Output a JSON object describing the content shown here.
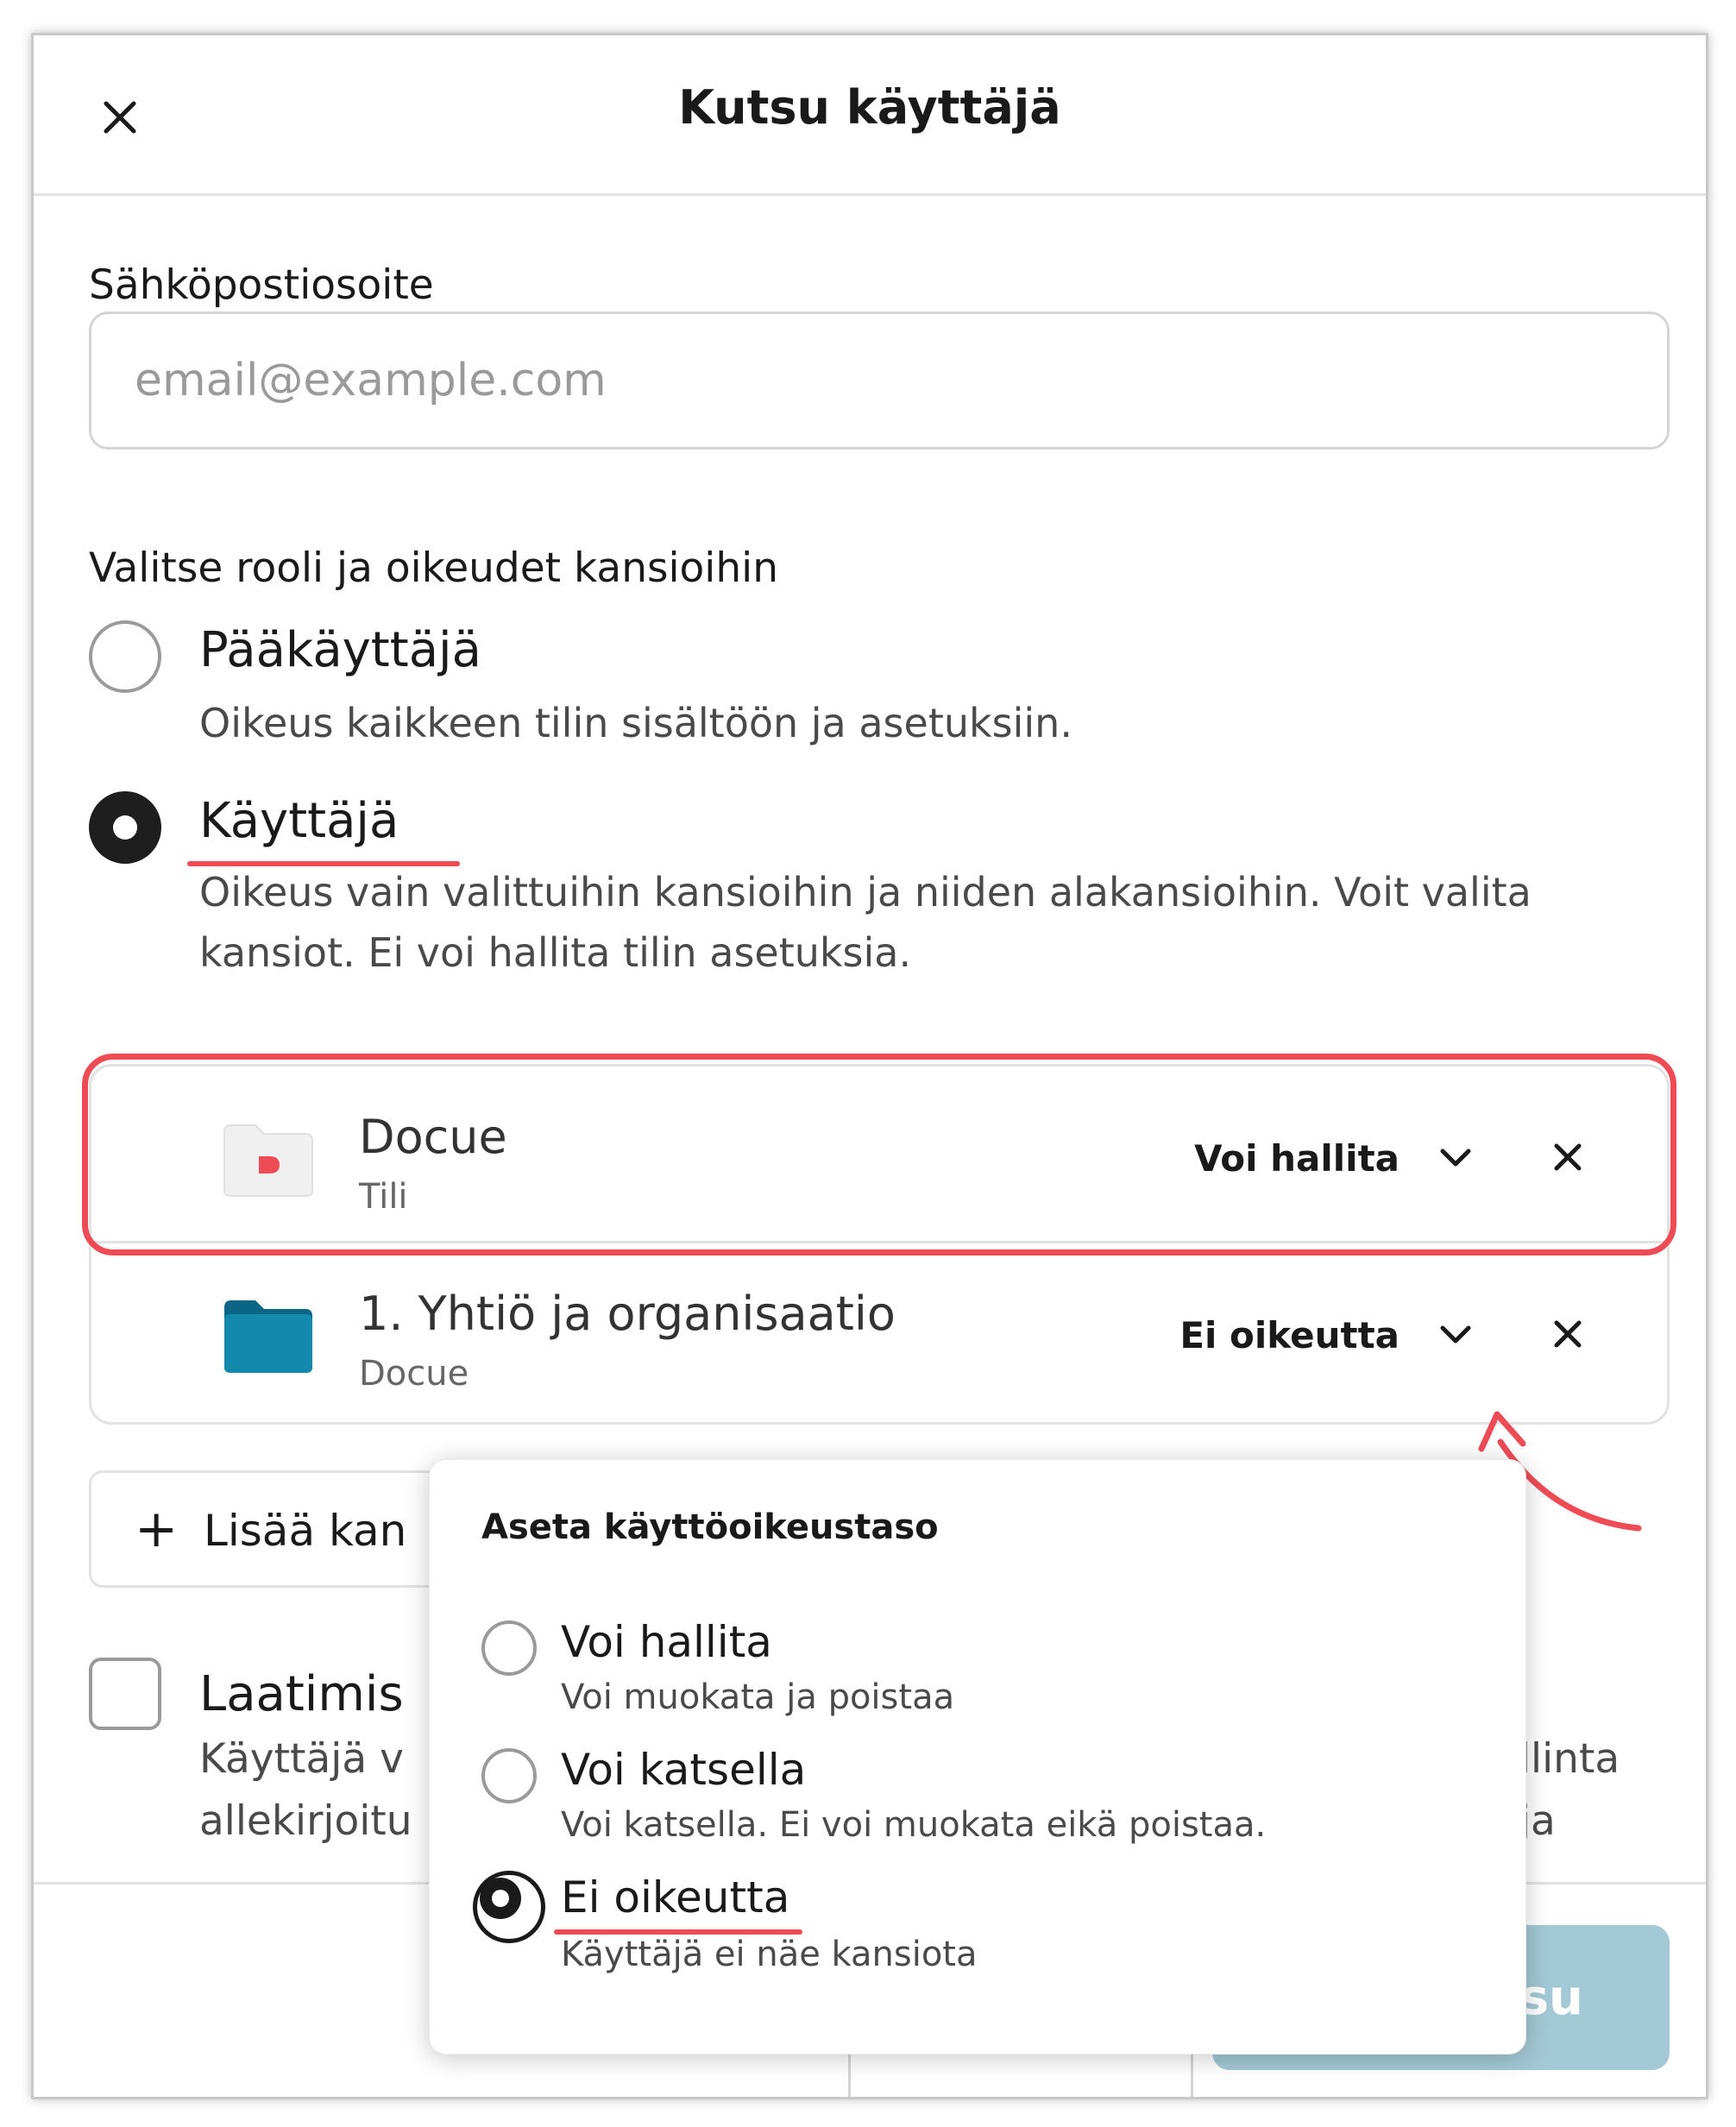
{
  "dialog": {
    "title": "Kutsu käyttäjä",
    "close_icon": "close-icon"
  },
  "email": {
    "label": "Sähköpostiosoite",
    "placeholder": "email@example.com",
    "value": ""
  },
  "role": {
    "heading": "Valitse rooli ja oikeudet kansioihin",
    "options": [
      {
        "title": "Pääkäyttäjä",
        "desc": "Oikeus kaikkeen tilin sisältöön ja asetuksiin.",
        "checked": false
      },
      {
        "title": "Käyttäjä",
        "desc": "Oikeus vain valittuihin kansioihin ja niiden alakansioihin. Voit valita kansiot. Ei voi hallita tilin asetuksia.",
        "checked": true
      }
    ]
  },
  "folders": [
    {
      "name": "Docue",
      "sub": "Tili",
      "permission": "Voi hallita",
      "icon": "docue-folder-icon"
    },
    {
      "name": "1. Yhtiö ja organisaatio",
      "sub": "Docue",
      "permission": "Ei oikeutta",
      "icon": "folder-icon"
    }
  ],
  "add_folder": {
    "label": "Lisää kan"
  },
  "contracts": {
    "title": "Laatimis",
    "desc_left_1": "Käyttäjä v",
    "desc_right_1": "llinta ja",
    "desc_left_2": "allekirjoitu"
  },
  "footer": {
    "submit_label": "utsu"
  },
  "dropdown": {
    "title": "Aseta käyttöoikeustaso",
    "options": [
      {
        "title": "Voi hallita",
        "desc": "Voi muokata ja poistaa",
        "checked": false
      },
      {
        "title": "Voi katsella",
        "desc": "Voi katsella. Ei voi muokata eikä poistaa.",
        "checked": false
      },
      {
        "title": "Ei oikeutta",
        "desc": "Käyttäjä ei näe kansiota",
        "checked": true
      }
    ]
  },
  "colors": {
    "accent_red": "#ef4b55",
    "folder_teal": "#0e7a9c",
    "submit_disabled": "#a3c8d6"
  }
}
